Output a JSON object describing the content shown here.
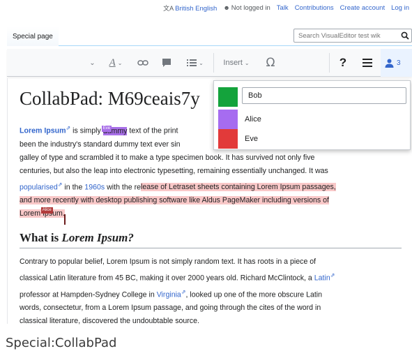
{
  "personal": {
    "language": "British English",
    "login_status": "Not logged in",
    "talk": "Talk",
    "contributions": "Contributions",
    "create_account": "Create account",
    "login": "Log in"
  },
  "tabs": {
    "special_page": "Special page"
  },
  "search": {
    "placeholder": "Search VisualEditor test wik"
  },
  "toolbar": {
    "insert_label": "Insert",
    "help_label": "?",
    "user_count": "3",
    "icons": [
      "undo-icon",
      "text-style-icon",
      "link-icon",
      "comment-icon",
      "list-icon",
      "insert-dropdown",
      "special-character-icon",
      "help-icon",
      "page-menu-icon",
      "users-icon"
    ]
  },
  "article": {
    "title": "CollabPad: M69ceais7y",
    "p1": {
      "link_lorem": "Lorem Ipsum",
      "is_simply": " is simply ",
      "dummy": "dummy",
      "after_dummy": " text of the print",
      "line2": "been the industry's standard dummy text ever sin",
      "line3": "galley of type and scrambled it to make a type specimen book. It has survived not only five",
      "line4": "centuries, but also the leap into electronic typesetting, remaining essentially unchanged. It was",
      "popularised": "popularised",
      "in_the": " in the ",
      "decade": "1960s",
      "with_the_re": " with the re",
      "alice_text_1": "lease of Letraset sheets containing Lorem Ipsum passages,",
      "alice_text_2": "and more recently with desktop publishing software like Aldus PageMaker including versions of",
      "alice_text_3": "Lorem Ipsum."
    },
    "cursor_labels": {
      "eve": "Eve",
      "alice": "Alice"
    },
    "heading": {
      "bold": "What",
      "plain": " is ",
      "italic": "Lorem Ipsum?"
    },
    "p2": {
      "l1": "Contrary to popular belief, Lorem Ipsum is not simply random text. It has roots in a piece of",
      "l2a": "classical Latin literature from 45 BC, making it over 2000 years old. Richard McClintock, a ",
      "latin": "Latin",
      "l3a": "professor at Hampden-Sydney College in ",
      "virginia": "Virginia",
      "l3b": ", looked up one of the more obscure Latin",
      "l4": "words, consectetur, from a Lorem Ipsum passage, and going through the cites of the word in",
      "l5": "classical literature, discovered the undoubtable source."
    }
  },
  "collab_popup": {
    "self": {
      "name": "Bob",
      "color": "#14a33c"
    },
    "users": [
      {
        "name": "Alice",
        "color": "#a66cf0"
      },
      {
        "name": "Eve",
        "color": "#e23a3a"
      }
    ]
  },
  "caption": "Special:CollabPad",
  "colors": {
    "link": "#3366cc",
    "eve_selection": "#a86fe8",
    "alice_selection": "#f5c4c4"
  }
}
